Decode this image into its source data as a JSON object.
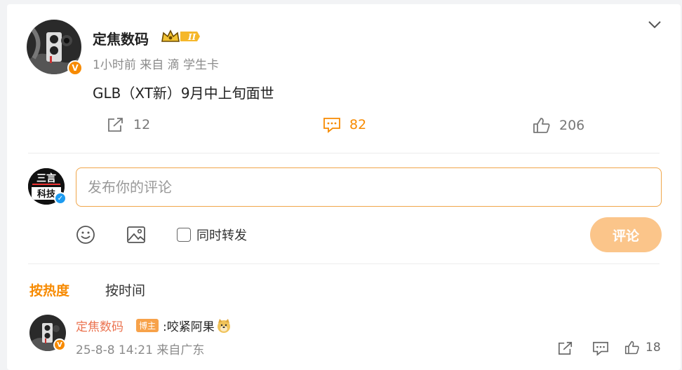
{
  "post": {
    "author": "定焦数码",
    "meta": "1小时前 来自 滴 学生卡",
    "text": "GLB（XT新）9月中上旬面世",
    "verified_badge": "V",
    "actions": {
      "repost_count": "12",
      "comment_count": "82",
      "like_count": "206"
    }
  },
  "composer": {
    "placeholder": "发布你的评论",
    "value": "",
    "also_repost_label": "同时转发",
    "submit_label": "评论",
    "avatar_text": "三言 科技"
  },
  "sort": {
    "hot_label": "按热度",
    "time_label": "按时间"
  },
  "comments": [
    {
      "author": "定焦数码",
      "tag": "博主",
      "text": ":咬紧阿果",
      "time": "25-8-8 14:21 来自广东",
      "like_count": "18",
      "badge": "V"
    }
  ],
  "colors": {
    "accent": "#f78a00",
    "submit_bg": "#fbc58a",
    "author_link": "#eb7350",
    "verified_blue": "#1d9bf0"
  }
}
